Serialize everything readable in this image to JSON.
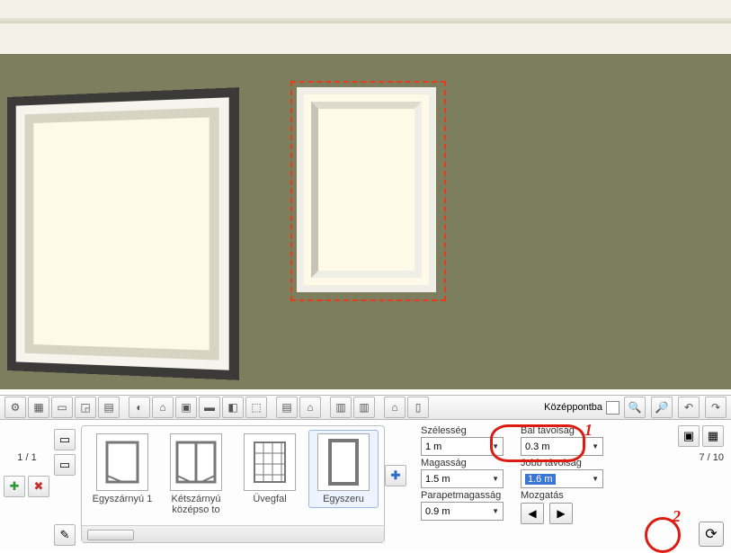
{
  "pager_left": "1 / 1",
  "pager_right": "7 / 10",
  "center_checkbox_label": "Középpontba",
  "gallery": {
    "items": [
      {
        "label": "Egyszárnyú 1"
      },
      {
        "label": "Kétszárnyú középso to"
      },
      {
        "label": "Üvegfal"
      },
      {
        "label": "Egyszeru"
      }
    ]
  },
  "props": {
    "width_label": "Szélesség",
    "width_value": "1 m",
    "left_label": "Bal távolság",
    "left_value": "0.3 m",
    "height_label": "Magasság",
    "height_value": "1.5 m",
    "right_label": "Jobb távolság",
    "right_value": "1.6 m",
    "parapet_label": "Parapetmagasság",
    "parapet_value": "0.9 m",
    "move_label": "Mozgatás"
  },
  "annotations": {
    "a1": "1",
    "a2": "2"
  },
  "icons": {
    "gear": "⚙",
    "grid": "▦",
    "palette": "▭",
    "switch": "◲",
    "pattern": "▤",
    "bulb": "◐",
    "chair": "⌂",
    "picture": "▣",
    "book": "▬",
    "cube": "◧",
    "paint": "⬚",
    "building": "▤",
    "house": "⌂",
    "wall1": "▥",
    "wall2": "▥",
    "bath": "⌂",
    "door": "▯",
    "search": "🔍",
    "zoom": "🔎",
    "undo": "↶",
    "redo": "↷",
    "plus": "✚",
    "x": "✖",
    "brush": "✎",
    "mini": "▭",
    "sync": "⟳",
    "left": "◀",
    "right": "▶",
    "brick": "▦",
    "img": "▣"
  }
}
